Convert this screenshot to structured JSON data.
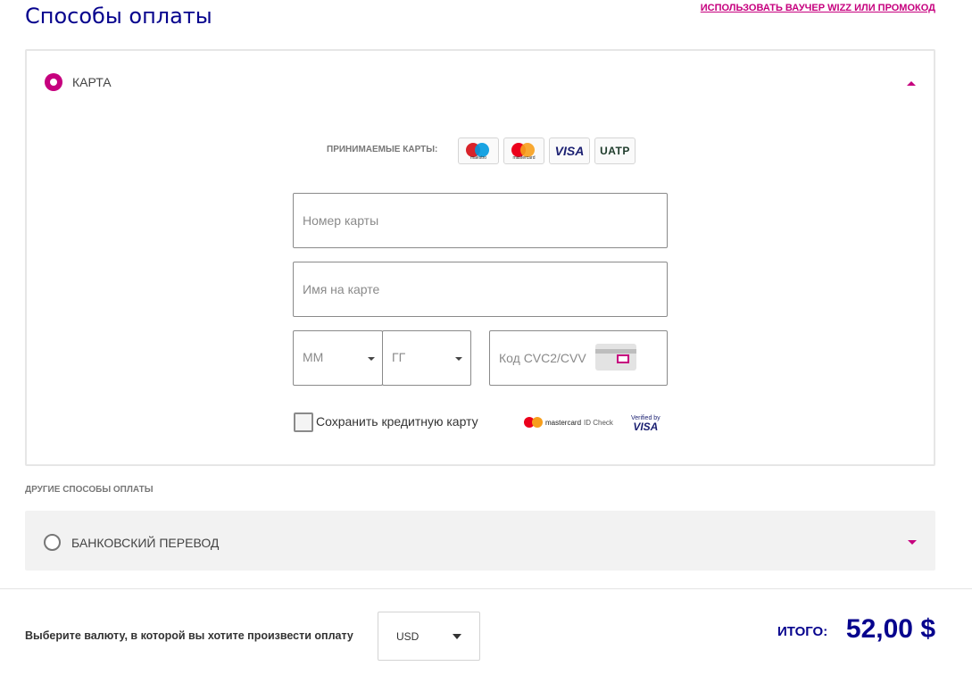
{
  "page": {
    "title": "Способы оплаты",
    "voucher_link": "ИСПОЛЬЗОВАТЬ ВАУЧЕР WIZZ ИЛИ ПРОМОКОД"
  },
  "card_method": {
    "label": "КАРТА",
    "selected": true,
    "accepted_label": "ПРИНИМАЕМЫЕ КАРТЫ:",
    "logos": {
      "maestro": "maestro",
      "mastercard": "mastercard",
      "visa": "VISA",
      "uatp": "UATP"
    },
    "card_number_placeholder": "Номер карты",
    "card_name_placeholder": "Имя на карте",
    "month_value": "ММ",
    "year_value": "ГГ",
    "cvc_placeholder": "Код CVC2/CVV",
    "save_card_label": "Сохранить кредитную карту",
    "save_card_checked": false,
    "mc_id_check": "mastercard",
    "mc_id_check_suffix": "ID Check",
    "verified_by": "Verified by",
    "verified_visa": "VISA"
  },
  "other_methods": {
    "heading": "ДРУГИЕ СПОСОБЫ ОПЛАТЫ",
    "bank_transfer_label": "БАНКОВСКИЙ ПЕРЕВОД"
  },
  "footer": {
    "currency_label": "Выберите валюту, в которой вы хотите произвести оплату",
    "currency_value": "USD",
    "total_label": "ИТОГО:",
    "total_value": "52,00 $"
  },
  "colors": {
    "brand_navy": "#06038d",
    "brand_magenta": "#c6007e"
  }
}
